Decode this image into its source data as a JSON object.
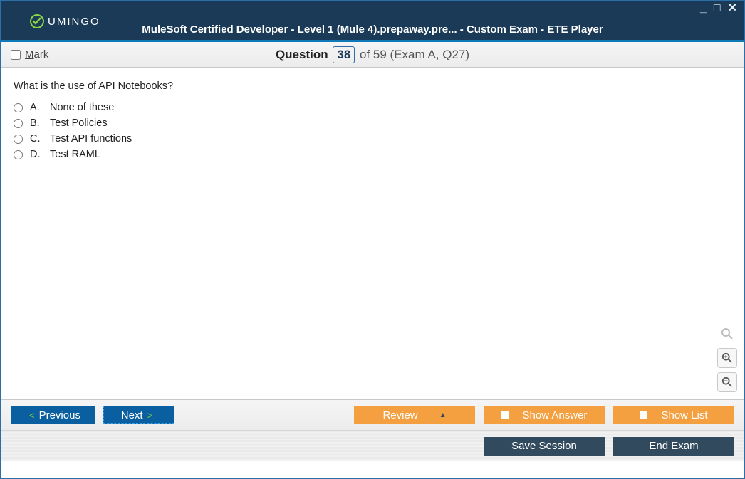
{
  "brand": "UMINGO",
  "title": "MuleSoft Certified Developer - Level 1 (Mule 4).prepaway.pre... - Custom Exam - ETE Player",
  "infobar": {
    "mark_label_pre": "M",
    "mark_label_rest": "ark",
    "question_word": "Question",
    "current": "38",
    "total_suffix": "of 59 (Exam A, Q27)"
  },
  "question": "What is the use of API Notebooks?",
  "options": [
    {
      "letter": "A.",
      "text": "None of these"
    },
    {
      "letter": "B.",
      "text": "Test Policies"
    },
    {
      "letter": "C.",
      "text": "Test API functions"
    },
    {
      "letter": "D.",
      "text": "Test RAML"
    }
  ],
  "buttons": {
    "previous": "Previous",
    "next": "Next",
    "review": "Review",
    "show_answer": "Show Answer",
    "show_list": "Show List",
    "save_session": "Save Session",
    "end_exam": "End Exam"
  }
}
